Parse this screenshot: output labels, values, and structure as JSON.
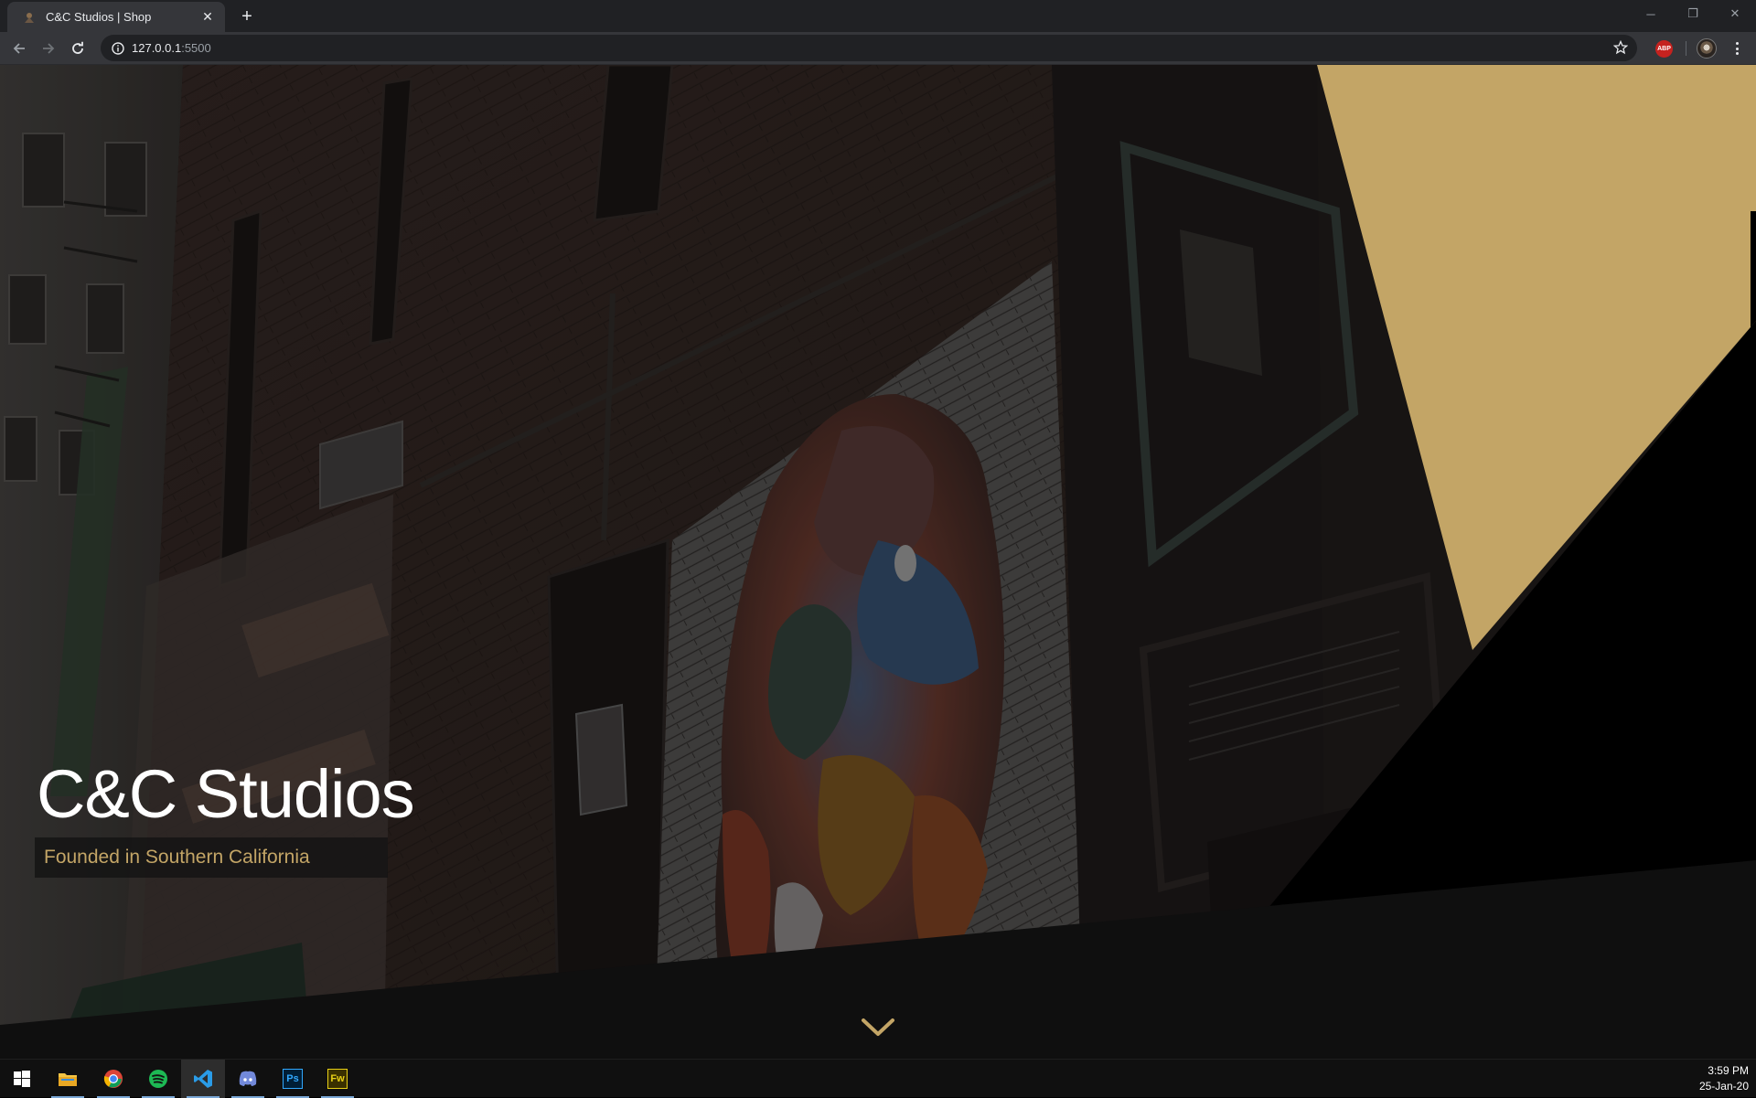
{
  "browser": {
    "tab_title": "C&C Studios | Shop",
    "tab_close": "✕",
    "new_tab": "+",
    "url_host": "127.0.0.1",
    "url_port": ":5500",
    "extension_abp": "ABP",
    "window_controls": {
      "minimize": "─",
      "restore": "❐",
      "close": "✕"
    }
  },
  "hero": {
    "title": "C&C Studios",
    "tagline": "Founded in Southern California",
    "accent_color": "#c3a566",
    "scroll_icon": "chevron-down-icon"
  },
  "taskbar": {
    "items": [
      "windows-start-icon",
      "file-explorer-icon",
      "chrome-icon",
      "spotify-icon",
      "vscode-icon",
      "discord-icon",
      "photoshop-icon",
      "fireworks-icon"
    ],
    "photoshop_label": "Ps",
    "fireworks_label": "Fw",
    "time": "3:59 PM",
    "date": "25-Jan-20"
  }
}
